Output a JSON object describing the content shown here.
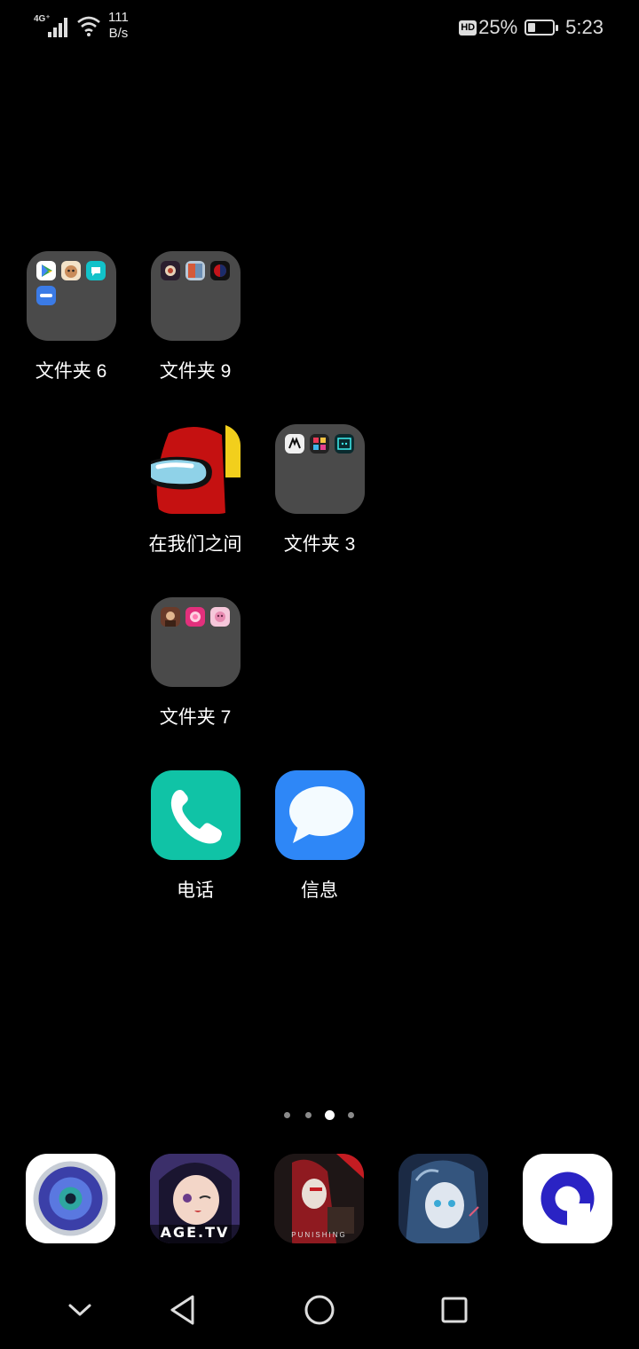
{
  "status_bar": {
    "network": "4G⁺",
    "speed_value": "111",
    "speed_unit": "B/s",
    "hd": "HD",
    "battery": "25%",
    "time": "5:23"
  },
  "apps": {
    "folder6": {
      "label": "文件夹 6"
    },
    "folder9": {
      "label": "文件夹 9"
    },
    "among_us": {
      "label": "在我们之间"
    },
    "folder3": {
      "label": "文件夹 3"
    },
    "folder7": {
      "label": "文件夹 7"
    },
    "phone": {
      "label": "电话"
    },
    "messages": {
      "label": "信息"
    }
  },
  "page_indicator": {
    "pages": 4,
    "current": 3
  },
  "dock": {
    "age_tv_text": "AGE.TV",
    "punishing_text": "PUNISHING"
  },
  "colors": {
    "background": "#000000",
    "folder": "#4a4a4a",
    "phone": "#10c3a6",
    "messages": "#2e87f7"
  }
}
